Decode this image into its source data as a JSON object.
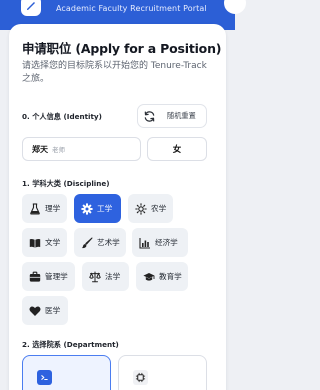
{
  "header": {
    "portal_title": "Academic Faculty Recruitment Portal",
    "brand_color": "#2c5fd6"
  },
  "page": {
    "title": "申请职位 (Apply for a Position)",
    "subtitle": "请选择您的目标院系以开始您的 Tenure-Track 之旅。"
  },
  "identity": {
    "label": "0. 个人信息 (Identity)",
    "reset_label": "随机重置",
    "reset_icon": "refresh-icon",
    "name_value": "郑天",
    "name_placeholder": "老师",
    "gender_value": "女"
  },
  "discipline": {
    "label": "1. 学科大类 (Discipline)",
    "accent_color": "#2e62df",
    "selected": "工学",
    "options": [
      {
        "label": "理学",
        "icon": "flask-icon"
      },
      {
        "label": "工学",
        "icon": "gear-icon"
      },
      {
        "label": "农学",
        "icon": "sun-icon"
      },
      {
        "label": "文学",
        "icon": "book-icon"
      },
      {
        "label": "艺术学",
        "icon": "brush-icon"
      },
      {
        "label": "经济学",
        "icon": "bar-chart-icon"
      },
      {
        "label": "管理学",
        "icon": "briefcase-icon"
      },
      {
        "label": "法学",
        "icon": "scales-icon"
      },
      {
        "label": "教育学",
        "icon": "graduation-cap-icon"
      },
      {
        "label": "医学",
        "icon": "heart-icon"
      }
    ]
  },
  "department": {
    "label": "2. 选择院系 (Department)",
    "cards": [
      {
        "icon": "terminal-icon",
        "selected": true
      },
      {
        "icon": "chip-icon",
        "selected": false
      }
    ]
  }
}
